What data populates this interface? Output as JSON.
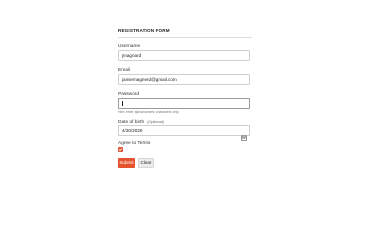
{
  "form": {
    "title": "REGISTRATION FORM",
    "username": {
      "label": "Username",
      "value": "jmagnard"
    },
    "email": {
      "label": "Email",
      "value": "jamiemagnerd@gmail.com"
    },
    "password": {
      "label": "Password",
      "value": "",
      "hint": "Hint: enter alphanumeric characters only"
    },
    "dob": {
      "label": "Date of birth",
      "optional": "(Optional)",
      "value": "4/30/2020"
    },
    "agree": {
      "label": "Agree to Terms",
      "checked": true
    },
    "submit_label": "Submit",
    "clear_label": "Clear"
  },
  "colors": {
    "accent": "#e4532d",
    "border": "#cfcfcf"
  },
  "icons": {
    "date_picker": "calendar-icon",
    "agree_check": "checkmark-icon"
  }
}
